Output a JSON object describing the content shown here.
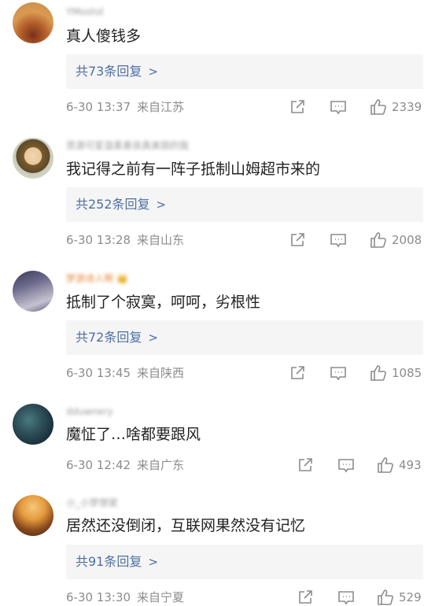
{
  "comments": [
    {
      "username": "YMootol",
      "text": "真人傻钱多",
      "replies_label": "共73条回复",
      "date": "6-30 13:37",
      "source": "来自江苏",
      "likes": "2339"
    },
    {
      "username": "思源可爱温柔善良真美丽的我",
      "text": "我记得之前有一阵子抵制山姆超市来的",
      "replies_label": "共252条回复",
      "date": "6-30 13:28",
      "source": "来自山东",
      "likes": "2008"
    },
    {
      "username": "梦游诗人啊",
      "text": "抵制了个寂寞，呵呵，劣根性",
      "replies_label": "共72条回复",
      "date": "6-30 13:45",
      "source": "来自陕西",
      "likes": "1085"
    },
    {
      "username": "dduwnery",
      "text": "魔怔了…啥都要跟风",
      "date": "6-30 12:42",
      "source": "来自广东",
      "likes": "493"
    },
    {
      "username": "小_小梦想家",
      "text": "居然还没倒闭，互联网果然没有记忆",
      "replies_label": "共91条回复",
      "date": "6-30 13:30",
      "source": "来自宁夏",
      "likes": "529"
    }
  ],
  "icons": {
    "share": "share-icon",
    "comment": "comment-icon",
    "like": "thumbs-up-icon"
  },
  "colors": {
    "reply_link": "#4e6fa3",
    "meta_text": "#8c8c8c",
    "reply_box_bg": "#f5f5f5",
    "vip_name": "#e08a3a"
  }
}
